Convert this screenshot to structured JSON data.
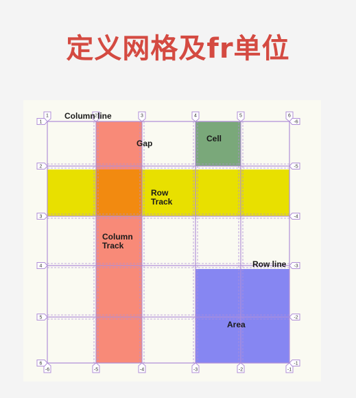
{
  "title": "定义网格及fr单位",
  "grid": {
    "columns": 6,
    "rows": 6,
    "top_labels": [
      "1",
      "2",
      "3",
      "4",
      "5",
      "6"
    ],
    "left_labels": [
      "1",
      "2",
      "3",
      "4",
      "5",
      "6"
    ],
    "right_labels": [
      "-6",
      "-5",
      "-4",
      "-3",
      "-2",
      "-1"
    ],
    "bottom_labels": [
      "-6",
      "-5",
      "-4",
      "-3",
      "-2",
      "-1"
    ]
  },
  "annotations": {
    "column_line": "Column line",
    "gap": "Gap",
    "cell": "Cell",
    "row_track": [
      "Row",
      "Track"
    ],
    "column_track": [
      "Column",
      "Track"
    ],
    "row_line": "Row line",
    "area": "Area"
  },
  "colors": {
    "title": "#d44a41",
    "grid_line": "#b08fd8",
    "column_track": "#f88a78",
    "row_track": "#e8e000",
    "intersection": "#f28a10",
    "cell": "#7aa87a",
    "area": "#8686f2"
  }
}
